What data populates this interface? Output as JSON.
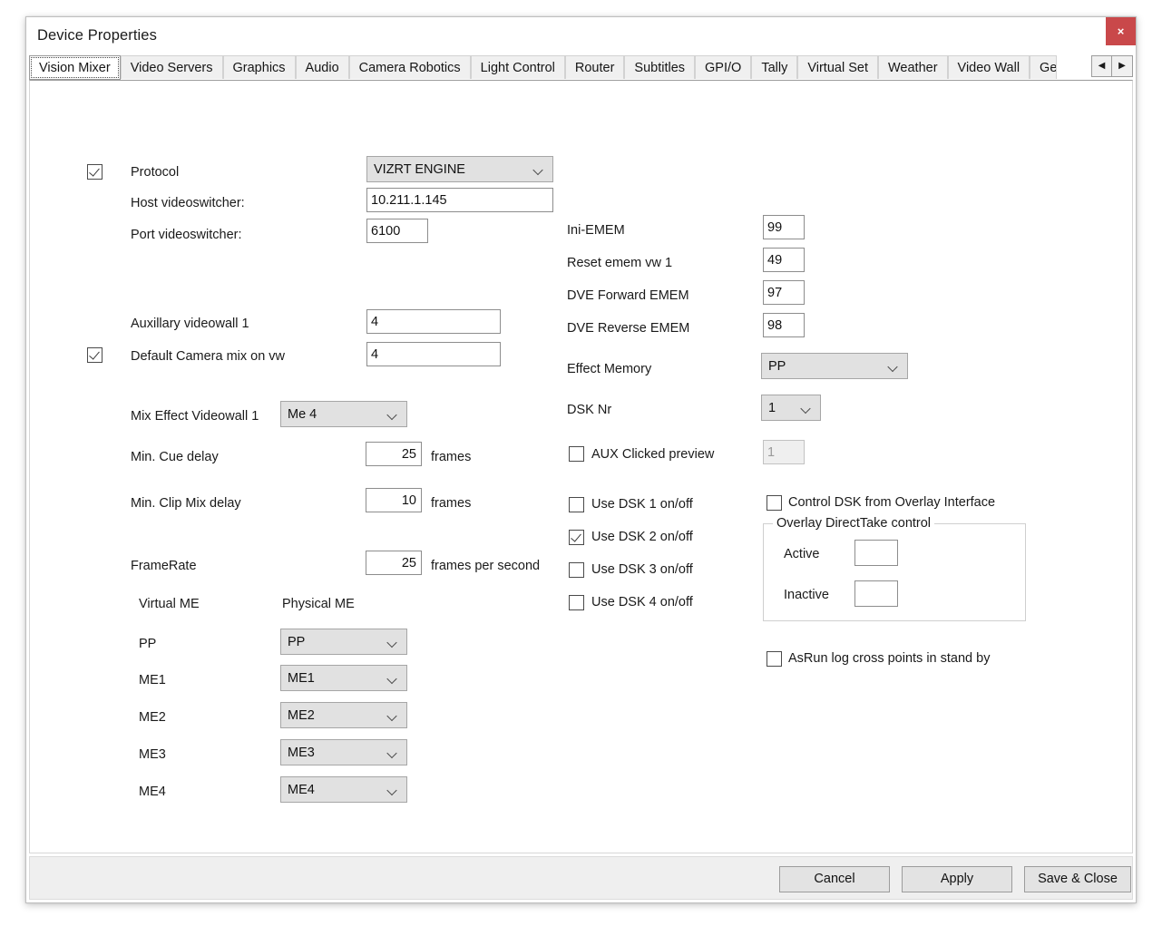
{
  "window": {
    "title": "Device Properties",
    "close_label": "×"
  },
  "tabs": {
    "items": [
      {
        "label": "Vision Mixer",
        "active": true
      },
      {
        "label": "Video Servers",
        "active": false
      },
      {
        "label": "Graphics",
        "active": false
      },
      {
        "label": "Audio",
        "active": false
      },
      {
        "label": "Camera Robotics",
        "active": false
      },
      {
        "label": "Light Control",
        "active": false
      },
      {
        "label": "Router",
        "active": false
      },
      {
        "label": "Subtitles",
        "active": false
      },
      {
        "label": "GPI/O",
        "active": false
      },
      {
        "label": "Tally",
        "active": false
      },
      {
        "label": "Virtual Set",
        "active": false
      },
      {
        "label": "Weather",
        "active": false
      },
      {
        "label": "Video Wall",
        "active": false
      },
      {
        "label": "General",
        "active": false
      }
    ],
    "scroll_left": "◀",
    "scroll_right": "▶"
  },
  "left_column": {
    "protocol": {
      "enabled_checked": true,
      "label": "Protocol",
      "value": "VIZRT ENGINE"
    },
    "host_videoswitcher": {
      "label": "Host videoswitcher:",
      "value": "10.211.1.145"
    },
    "port_videoswitcher": {
      "label": "Port videoswitcher:",
      "value": "6100"
    },
    "auxillary_videowall_1": {
      "label": "Auxillary videowall 1",
      "value": "4"
    },
    "default_camera_mix_on_vw": {
      "checked": true,
      "label": "Default Camera mix on vw",
      "value": "4"
    },
    "mix_effect_videowall_1": {
      "label": "Mix Effect Videowall 1",
      "value": "Me 4"
    },
    "min_cue_delay": {
      "label": "Min. Cue delay",
      "value": "25",
      "unit": "frames"
    },
    "min_clip_mix_delay": {
      "label": "Min. Clip Mix delay",
      "value": "10",
      "unit": "frames"
    },
    "framerate": {
      "label": "FrameRate",
      "value": "25",
      "unit": "frames per second"
    },
    "me_table": {
      "header_virtual": "Virtual ME",
      "header_physical": "Physical ME",
      "rows": [
        {
          "virtual": "PP",
          "physical": "PP"
        },
        {
          "virtual": "ME1",
          "physical": "ME1"
        },
        {
          "virtual": "ME2",
          "physical": "ME2"
        },
        {
          "virtual": "ME3",
          "physical": "ME3"
        },
        {
          "virtual": "ME4",
          "physical": "ME4"
        }
      ]
    }
  },
  "right_column": {
    "ini_emem": {
      "label": "Ini-EMEM",
      "value": "99"
    },
    "reset_emem_vw_1": {
      "label": "Reset emem vw 1",
      "value": "49"
    },
    "dve_forward_emem": {
      "label": "DVE Forward EMEM",
      "value": "97"
    },
    "dve_reverse_emem": {
      "label": "DVE Reverse EMEM",
      "value": "98"
    },
    "effect_memory": {
      "label": "Effect Memory",
      "value": "PP"
    },
    "dsk_nr": {
      "label": "DSK Nr",
      "value": "1"
    },
    "aux_clicked_preview": {
      "checked": false,
      "label": "AUX Clicked preview",
      "value": "1",
      "disabled": true
    },
    "dsk_toggles": [
      {
        "label": "Use DSK 1 on/off",
        "checked": false
      },
      {
        "label": "Use DSK 2 on/off",
        "checked": true
      },
      {
        "label": "Use DSK 3 on/off",
        "checked": false
      },
      {
        "label": "Use DSK 4 on/off",
        "checked": false
      }
    ],
    "control_dsk_from_overlay": {
      "label": "Control DSK from Overlay Interface",
      "checked": false
    },
    "overlay_directtake": {
      "title": "Overlay DirectTake control",
      "active_label": "Active",
      "active_value": "",
      "inactive_label": "Inactive",
      "inactive_value": ""
    },
    "asrun_log": {
      "label": "AsRun log cross points in stand by",
      "checked": false
    }
  },
  "footer": {
    "cancel": "Cancel",
    "apply": "Apply",
    "save_close": "Save & Close"
  }
}
